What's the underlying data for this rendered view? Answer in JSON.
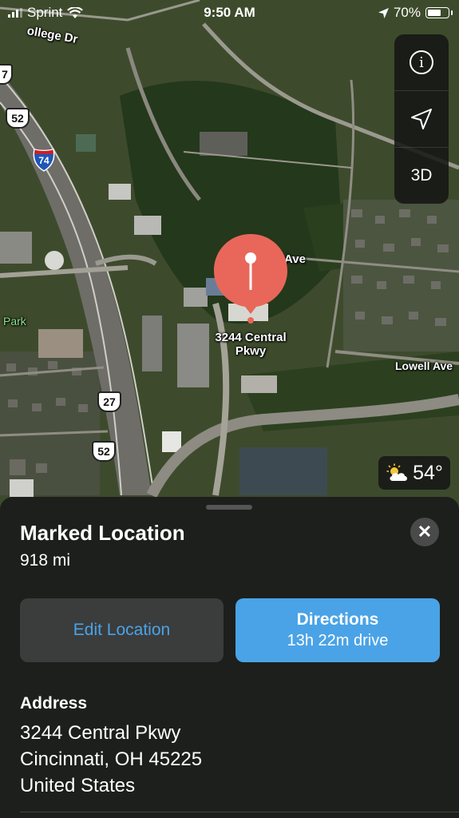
{
  "status_bar": {
    "carrier": "Sprint",
    "time": "9:50 AM",
    "battery": "70%",
    "battery_level": 0.7
  },
  "map": {
    "labels": {
      "college_dr": "ollege Dr",
      "ave": "Ave",
      "lowell_ave": "Lowell Ave",
      "park": "Park",
      "place_line1": "3244 Central",
      "place_line2": "Pkwy"
    },
    "shields": {
      "i74": "74",
      "us52_top": "52",
      "us27": "27",
      "us52_bottom": "52",
      "edge": "7"
    },
    "controls": {
      "threed": "3D"
    },
    "weather": {
      "temp": "54°",
      "icon": "partly-cloudy-icon"
    }
  },
  "sheet": {
    "title": "Marked Location",
    "distance": "918 mi",
    "edit_label": "Edit Location",
    "directions_label": "Directions",
    "directions_sub": "13h 22m drive",
    "address_header": "Address",
    "address_line1": "3244 Central Pkwy",
    "address_line2": "Cincinnati, OH  45225",
    "address_line3": "United States"
  },
  "colors": {
    "pin": "#e8675a",
    "accent": "#4aa3e6",
    "sheet": "#1c1d1c"
  }
}
